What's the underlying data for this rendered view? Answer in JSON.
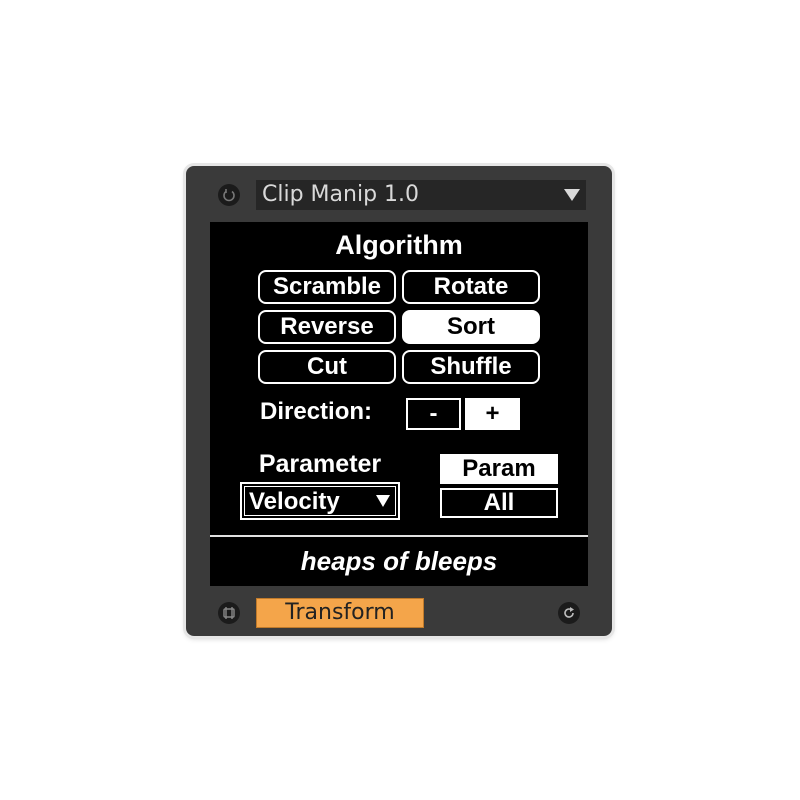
{
  "device": {
    "preset_name": "Clip Manip 1.0",
    "icons": {
      "power": "power-icon",
      "preset_arrow": "chevron-down-icon",
      "map": "map-icon",
      "refresh": "refresh-icon"
    }
  },
  "algorithm": {
    "title": "Algorithm",
    "options": [
      {
        "label": "Scramble",
        "selected": false
      },
      {
        "label": "Rotate",
        "selected": false
      },
      {
        "label": "Reverse",
        "selected": false
      },
      {
        "label": "Sort",
        "selected": true
      },
      {
        "label": "Cut",
        "selected": false
      },
      {
        "label": "Shuffle",
        "selected": false
      }
    ]
  },
  "direction": {
    "label": "Direction:",
    "minus": "-",
    "plus": "+",
    "selected": "+"
  },
  "parameter": {
    "label": "Parameter",
    "value": "Velocity",
    "mode_param": "Param",
    "mode_all": "All",
    "mode_selected": "Param"
  },
  "tagline": "heaps of bleeps",
  "transform_label": "Transform",
  "colors": {
    "transform": "#f4a54a",
    "panel": "#000000",
    "frame": "#3a3a3a"
  }
}
